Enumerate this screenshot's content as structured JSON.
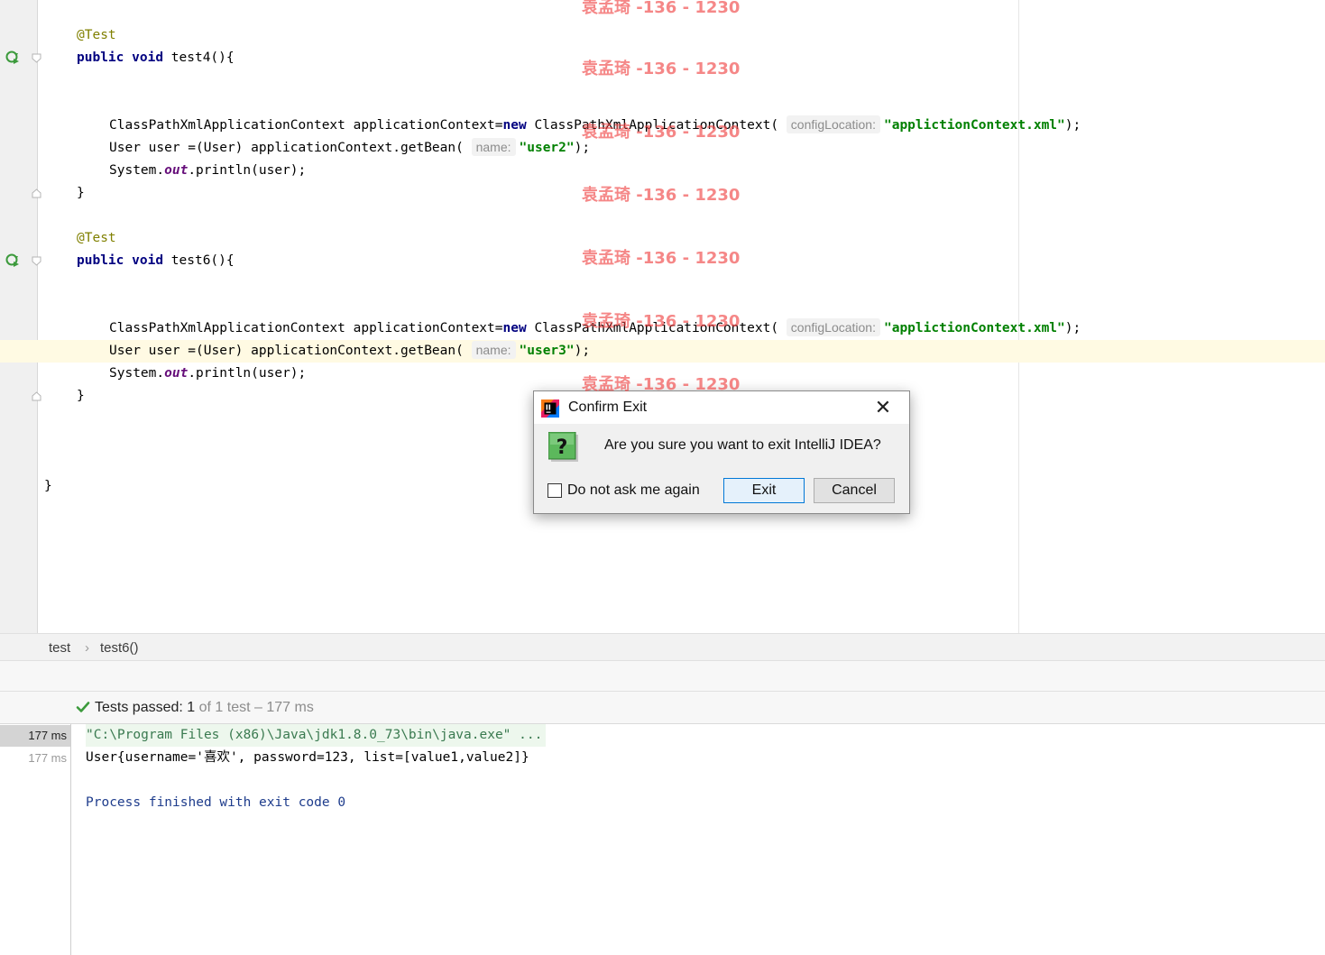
{
  "editor": {
    "test4": {
      "annotation": "@Test",
      "kw_public": "public",
      "kw_void": "void",
      "signature": "test4(){",
      "ctx_type": "ClassPathXmlApplicationContext applicationContext=",
      "kw_new": "new",
      "ctx_ctor": "ClassPathXmlApplicationContext(",
      "hint_config": "configLocation:",
      "config_value": "\"applictionContext.xml\"",
      "ctx_end": ");",
      "getbean_prefix": "User user =(User) applicationContext.getBean(",
      "hint_name": "name:",
      "bean_value": "\"user2\"",
      "getbean_end": ");",
      "print_prefix": "System.",
      "print_field": "out",
      "print_suffix": ".println(user);",
      "close_brace": "}"
    },
    "test6": {
      "annotation": "@Test",
      "kw_public": "public",
      "kw_void": "void",
      "signature": "test6(){",
      "ctx_type": "ClassPathXmlApplicationContext applicationContext=",
      "kw_new": "new",
      "ctx_ctor": "ClassPathXmlApplicationContext(",
      "hint_config": "configLocation:",
      "config_value": "\"applictionContext.xml\"",
      "ctx_end": ");",
      "getbean_prefix": "User user =(User) applicationContext.getBean(",
      "hint_name": "name:",
      "bean_value": "\"user3\"",
      "getbean_end": ");",
      "print_prefix": "System.",
      "print_field": "out",
      "print_suffix": ".println(user);",
      "close_brace": "}"
    },
    "class_close": "}"
  },
  "breadcrumb": {
    "class": "test",
    "separator": "›",
    "method": "test6()"
  },
  "run": {
    "status_label": "Tests passed:",
    "passed": "1",
    "of_total": "of 1 test – 177 ms",
    "rows": [
      {
        "time": "177 ms",
        "text": "\"C:\\Program Files (x86)\\Java\\jdk1.8.0_73\\bin\\java.exe\" ..."
      },
      {
        "time": "177 ms",
        "text": "User{username='喜欢', password=123, list=[value1,value2]}"
      }
    ],
    "finished": "Process finished with exit code 0"
  },
  "dialog": {
    "title": "Confirm Exit",
    "close_glyph": "✕",
    "message": "Are you sure you want to exit IntelliJ IDEA?",
    "checkbox_label": "Do not ask me again",
    "checkbox_checked": false,
    "exit_label": "Exit",
    "cancel_label": "Cancel"
  },
  "watermark": "袁孟琦 -136 - 1230",
  "colors": {
    "keyword": "#000080",
    "annotation": "#808000",
    "string": "#008000",
    "static_field": "#660e7a",
    "current_line": "#fffae3",
    "watermark": "#f04646",
    "primary_button_border": "#0078d7"
  },
  "icons": [
    "run-test-icon",
    "fold-icon",
    "intellij-app-icon",
    "close-icon",
    "question-icon",
    "check-icon"
  ]
}
